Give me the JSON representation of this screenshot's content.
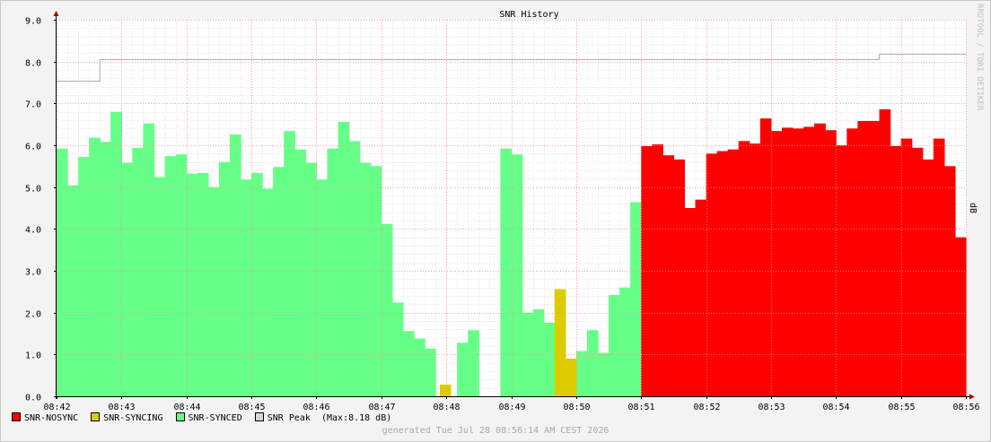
{
  "chart_data": {
    "type": "bar",
    "title": "SNR History",
    "ylabel": "dB",
    "ylim": [
      0,
      9
    ],
    "yticks": [
      "0.0",
      "1.0",
      "2.0",
      "3.0",
      "4.0",
      "5.0",
      "6.0",
      "7.0",
      "8.0",
      "9.0"
    ],
    "xticks": [
      "08:42",
      "08:43",
      "08:44",
      "08:45",
      "08:46",
      "08:47",
      "08:48",
      "08:49",
      "08:50",
      "08:51",
      "08:52",
      "08:53",
      "08:54",
      "08:55",
      "08:56"
    ],
    "x_range_minutes": [
      0,
      14
    ],
    "bar_width_minutes": 0.1667,
    "watermark": "RRDTOOL / TOBI OETIKER",
    "series": [
      {
        "name": "SNR-SYNCED",
        "color": "#66ff88",
        "points": [
          [
            0.0,
            5.92
          ],
          [
            0.1667,
            5.04
          ],
          [
            0.3333,
            5.72
          ],
          [
            0.5,
            6.18
          ],
          [
            0.6667,
            6.08
          ],
          [
            0.8333,
            6.8
          ],
          [
            1.0,
            5.58
          ],
          [
            1.1667,
            5.94
          ],
          [
            1.3333,
            6.52
          ],
          [
            1.5,
            5.24
          ],
          [
            1.6667,
            5.74
          ],
          [
            1.8333,
            5.78
          ],
          [
            2.0,
            5.32
          ],
          [
            2.1667,
            5.34
          ],
          [
            2.3333,
            5.0
          ],
          [
            2.5,
            5.6
          ],
          [
            2.6667,
            6.26
          ],
          [
            2.8333,
            5.18
          ],
          [
            3.0,
            5.34
          ],
          [
            3.1667,
            4.96
          ],
          [
            3.3333,
            5.48
          ],
          [
            3.5,
            6.34
          ],
          [
            3.6667,
            5.9
          ],
          [
            3.8333,
            5.58
          ],
          [
            4.0,
            5.18
          ],
          [
            4.1667,
            5.92
          ],
          [
            4.3333,
            6.56
          ],
          [
            4.5,
            6.1
          ],
          [
            4.6667,
            5.58
          ],
          [
            4.8333,
            5.5
          ],
          [
            5.0,
            4.12
          ],
          [
            5.1667,
            2.24
          ],
          [
            5.3333,
            1.56
          ],
          [
            5.5,
            1.38
          ],
          [
            5.6667,
            1.14
          ],
          [
            6.1667,
            1.28
          ],
          [
            6.3333,
            1.58
          ],
          [
            6.8333,
            5.92
          ],
          [
            7.0,
            5.78
          ],
          [
            7.1667,
            2.0
          ],
          [
            7.3333,
            2.08
          ],
          [
            7.5,
            1.76
          ],
          [
            8.0,
            1.08
          ],
          [
            8.1667,
            1.58
          ],
          [
            8.3333,
            1.04
          ],
          [
            8.5,
            2.42
          ],
          [
            8.6667,
            2.6
          ],
          [
            8.8333,
            4.64
          ]
        ]
      },
      {
        "name": "SNR-SYNCING",
        "color": "#ddcc00",
        "points": [
          [
            5.9,
            0.28
          ],
          [
            7.6667,
            2.56
          ],
          [
            7.8333,
            0.9
          ]
        ]
      },
      {
        "name": "SNR-NOSYNC",
        "color": "#ff0000",
        "points": [
          [
            9.0,
            5.98
          ],
          [
            9.1667,
            6.02
          ],
          [
            9.3333,
            5.76
          ],
          [
            9.5,
            5.66
          ],
          [
            9.6667,
            4.5
          ],
          [
            9.8333,
            4.7
          ],
          [
            10.0,
            5.8
          ],
          [
            10.1667,
            5.86
          ],
          [
            10.3333,
            5.9
          ],
          [
            10.5,
            6.1
          ],
          [
            10.6667,
            6.04
          ],
          [
            10.8333,
            6.64
          ],
          [
            11.0,
            6.34
          ],
          [
            11.1667,
            6.42
          ],
          [
            11.3333,
            6.4
          ],
          [
            11.5,
            6.44
          ],
          [
            11.6667,
            6.52
          ],
          [
            11.8333,
            6.36
          ],
          [
            12.0,
            6.0
          ],
          [
            12.1667,
            6.4
          ],
          [
            12.3333,
            6.58
          ],
          [
            12.5,
            6.58
          ],
          [
            12.6667,
            6.86
          ],
          [
            12.8333,
            5.98
          ],
          [
            13.0,
            6.16
          ],
          [
            13.1667,
            5.94
          ],
          [
            13.3333,
            5.66
          ],
          [
            13.5,
            6.16
          ],
          [
            13.6667,
            5.5
          ],
          [
            13.8333,
            3.8
          ]
        ]
      }
    ],
    "peak_series": {
      "name": "SNR Peak",
      "color": "#b0b0b0",
      "steps": [
        [
          0.0,
          7.54
        ],
        [
          0.6667,
          8.06
        ],
        [
          12.6667,
          8.18
        ],
        [
          14.0,
          8.18
        ]
      ]
    },
    "legend": [
      {
        "label": "SNR-NOSYNC",
        "color": "#ff0000"
      },
      {
        "label": "SNR-SYNCING",
        "color": "#ddcc00"
      },
      {
        "label": "SNR-SYNCED",
        "color": "#66ff88"
      },
      {
        "label": "SNR Peak  (Max:8.18 dB)",
        "color": "#d8d8d8"
      }
    ]
  },
  "footer": {
    "generated": "generated Tue Jul 28 08:56:14 AM CEST 2026"
  }
}
